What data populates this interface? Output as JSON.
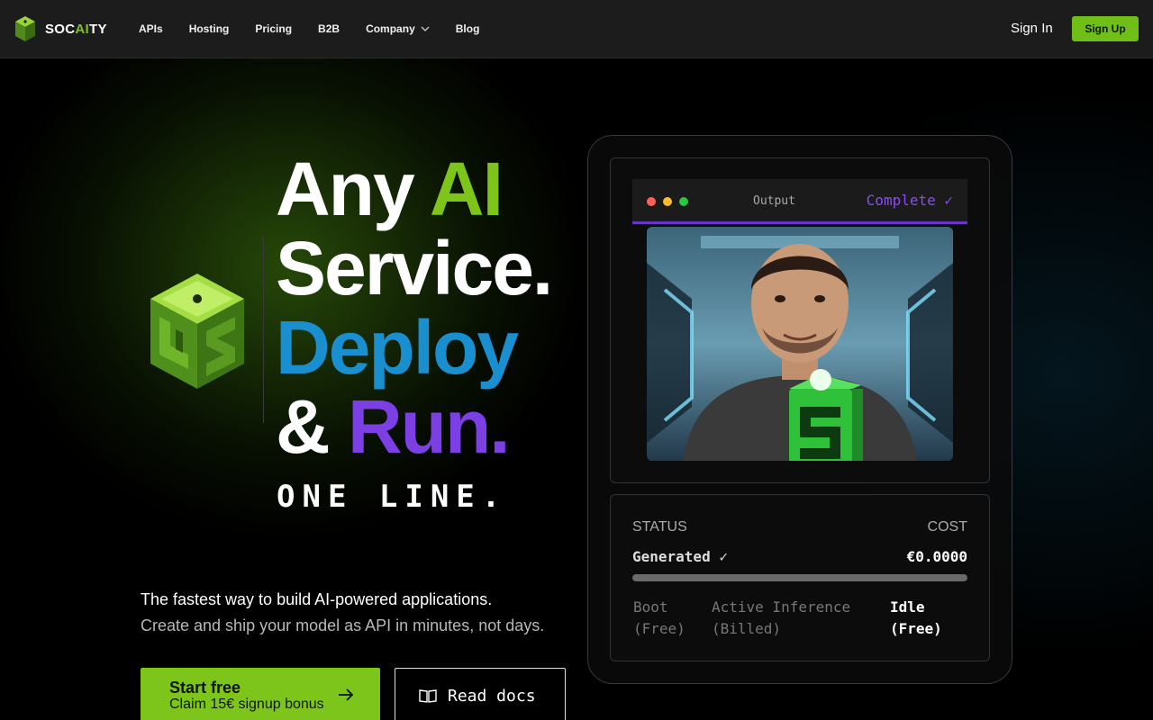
{
  "nav": {
    "brand_pre": "SOC",
    "brand_ai": "AI",
    "brand_post": "TY",
    "links": [
      "APIs",
      "Hosting",
      "Pricing",
      "B2B",
      "Company",
      "Blog"
    ],
    "sign_in": "Sign In",
    "sign_up": "Sign Up"
  },
  "hero": {
    "line1_a": "Any ",
    "line1_b": "AI",
    "line2": "Service.",
    "line3": "Deploy",
    "line4_a": "& ",
    "line4_b": "Run",
    "line4_c": ".",
    "one_line": "ONE LINE.",
    "tagline": "The fastest way to build AI-powered applications.",
    "subtagline": "Create and ship your model as API in minutes, not days.",
    "start_title": "Start free",
    "start_sub": "Claim 15€ signup bonus",
    "docs": "Read docs"
  },
  "output": {
    "title": "Output",
    "status": "Complete ✓"
  },
  "status": {
    "status_label": "STATUS",
    "cost_label": "COST",
    "generated": "Generated ✓",
    "cost": "€0.0000",
    "progress": 1.0,
    "phases": [
      {
        "name": "Boot",
        "note": "(Free)"
      },
      {
        "name": "Active Inference",
        "note": "(Billed)"
      },
      {
        "name": "Idle",
        "note": "(Free)"
      }
    ]
  },
  "colors": {
    "accent_green": "#7dc51b",
    "accent_blue": "#1a8fd0",
    "accent_purple": "#7b3fe4"
  }
}
